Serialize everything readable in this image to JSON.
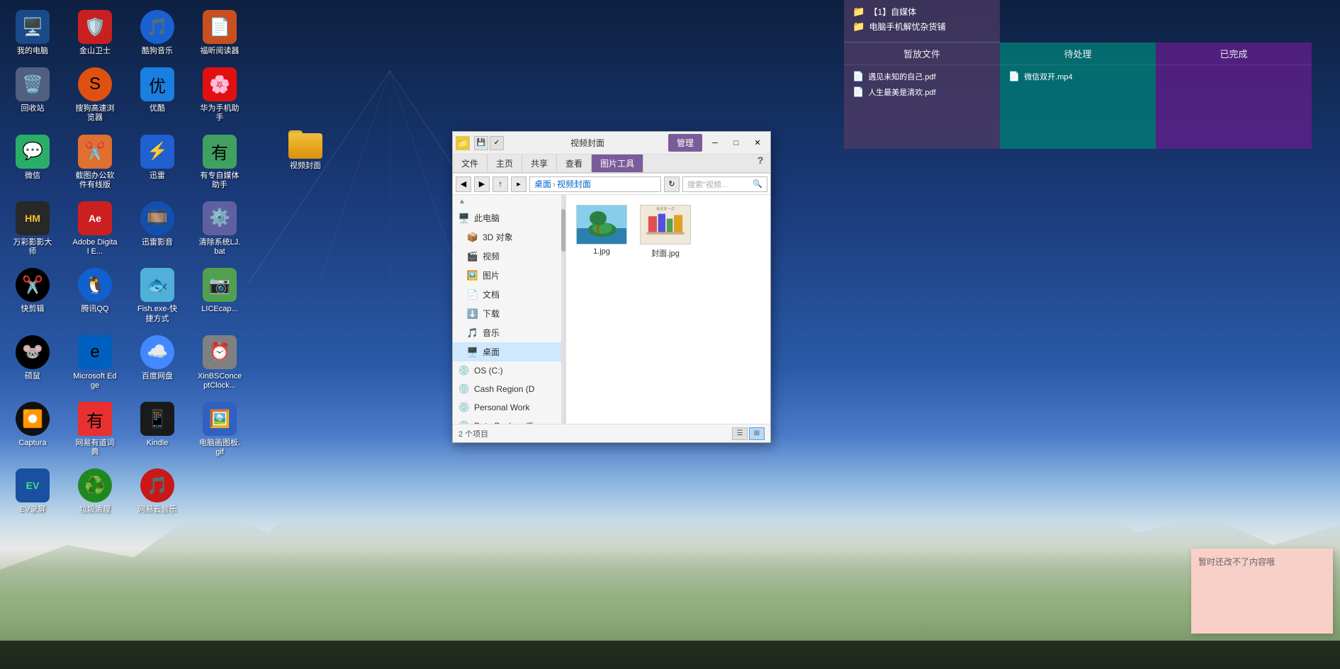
{
  "desktop": {
    "bg_gradient": "linear-gradient(180deg, #0d2040, #2a5aa8, #8ab4e0, #c8dce8)",
    "icons": [
      {
        "id": "my-computer",
        "label": "我的电脑",
        "emoji": "🖥️",
        "color": "#4488cc"
      },
      {
        "id": "jinshan-guard",
        "label": "金山卫士",
        "emoji": "🛡️",
        "color": "#e85050"
      },
      {
        "id": "kugou-music",
        "label": "酷狗音乐",
        "emoji": "🎵",
        "color": "#4488ff"
      },
      {
        "id": "fuyin-reader",
        "label": "福昕阅读器",
        "emoji": "📄",
        "color": "#e06020"
      },
      {
        "id": "recycle-bin",
        "label": "回收站",
        "emoji": "🗑️",
        "color": "#80a0c0"
      },
      {
        "id": "sogou-browser",
        "label": "搜狗高速浏览器",
        "emoji": "🔍",
        "color": "#f07020"
      },
      {
        "id": "youku",
        "label": "优酷",
        "emoji": "▶️",
        "color": "#2090e8"
      },
      {
        "id": "huawei-phone",
        "label": "华为手机助手",
        "emoji": "📱",
        "color": "#e82020"
      },
      {
        "id": "wechat",
        "label": "微信",
        "emoji": "💬",
        "color": "#2aae67"
      },
      {
        "id": "jietuban",
        "label": "截图办公软件有线版",
        "emoji": "✂️",
        "color": "#f08030"
      },
      {
        "id": "xunlei",
        "label": "迅雷",
        "emoji": "⚡",
        "color": "#2080e8"
      },
      {
        "id": "youzhuanmei",
        "label": "有专自媒体助手",
        "emoji": "🎬",
        "color": "#40a860"
      },
      {
        "id": "wansai",
        "label": "万彩影影大师",
        "emoji": "🎭",
        "color": "#303030"
      },
      {
        "id": "adobe-digital",
        "label": "Adobe Digital E...",
        "emoji": "📚",
        "color": "#cc2020"
      },
      {
        "id": "xunlei-shadow",
        "label": "迅雷影音",
        "emoji": "🎞️",
        "color": "#1060c0"
      },
      {
        "id": "qingjie-bat",
        "label": "清除系统LJ.bat",
        "emoji": "⚙️",
        "color": "#8080a0"
      },
      {
        "id": "kuaijian",
        "label": "快剪辑",
        "emoji": "✂️",
        "color": "#20a0e0"
      },
      {
        "id": "tencent-qq",
        "label": "腾讯QQ",
        "emoji": "🐧",
        "color": "#1a78d8"
      },
      {
        "id": "fish-exe",
        "label": "Fish.exe-快捷方式",
        "emoji": "🐟",
        "color": "#60c0e0"
      },
      {
        "id": "licecap",
        "label": "LICEcap...",
        "emoji": "🖼️",
        "color": "#60a060"
      },
      {
        "id": "shuoshu",
        "label": "硕鼠",
        "emoji": "🐭",
        "color": "#d04820"
      },
      {
        "id": "microsoft-edge",
        "label": "Microsoft Edge",
        "emoji": "🌐",
        "color": "#0078d4"
      },
      {
        "id": "baidu-pan",
        "label": "百度网盘",
        "emoji": "☁️",
        "color": "#4488ff"
      },
      {
        "id": "xinbsconc",
        "label": "XinBSConceptClock...",
        "emoji": "⏰",
        "color": "#888888"
      },
      {
        "id": "captura",
        "label": "Captura",
        "emoji": "🎥",
        "color": "#303030"
      },
      {
        "id": "youdao-dict",
        "label": "网易有道词典",
        "emoji": "📖",
        "color": "#e85050"
      },
      {
        "id": "kindle",
        "label": "Kindle",
        "emoji": "📱",
        "color": "#1a1a1a"
      },
      {
        "id": "pc-draw-gif",
        "label": "电脑画图板.gif",
        "emoji": "🖼️",
        "color": "#4080c0"
      },
      {
        "id": "ev-recorder",
        "label": "EV录屏",
        "emoji": "⏺️",
        "color": "#2060a0"
      },
      {
        "id": "trash-clean",
        "label": "垃圾清理",
        "emoji": "♻️",
        "color": "#40b840"
      },
      {
        "id": "netease-music",
        "label": "网易云音乐",
        "emoji": "🎵",
        "color": "#e82020"
      }
    ],
    "folder_label": "视频封面"
  },
  "sticky_panel": {
    "col1": {
      "header": "暂放文件",
      "color": "#7a5880",
      "items": [
        {
          "text": "遇见未知的自己.pdf",
          "icon": "📄"
        },
        {
          "text": "人生最美是清欢.pdf",
          "icon": "📄"
        }
      ]
    },
    "col2": {
      "header": "待处理",
      "color": "#009688",
      "items": [
        {
          "text": "微信双开.mp4",
          "icon": "🎥"
        }
      ]
    },
    "col3": {
      "header": "已完成",
      "color": "#7b2fbe",
      "items": []
    },
    "folder1": {
      "text": "【1】自媒体"
    },
    "folder2": {
      "text": "电脑手机解忧杂货铺"
    }
  },
  "file_window": {
    "title": "视频封面",
    "tab_manage": "管理",
    "ribbon_tabs": [
      "文件",
      "主页",
      "共享",
      "查看",
      "图片工具"
    ],
    "active_tab": "图片工具",
    "address": {
      "segments": [
        "桌面",
        "视频封面"
      ],
      "search_placeholder": "搜索\"视频..."
    },
    "sidebar_items": [
      {
        "label": "此电脑",
        "icon": "🖥️",
        "type": "header"
      },
      {
        "label": "3D 对象",
        "icon": "📦",
        "type": "item"
      },
      {
        "label": "视频",
        "icon": "🎬",
        "type": "item"
      },
      {
        "label": "图片",
        "icon": "🖼️",
        "type": "item"
      },
      {
        "label": "文档",
        "icon": "📄",
        "type": "item"
      },
      {
        "label": "下载",
        "icon": "⬇️",
        "type": "item"
      },
      {
        "label": "音乐",
        "icon": "🎵",
        "type": "item"
      },
      {
        "label": "桌面",
        "icon": "🖥️",
        "type": "item",
        "active": true
      },
      {
        "label": "OS (C:)",
        "icon": "💾",
        "type": "item"
      },
      {
        "label": "Cash Region (D",
        "icon": "💾",
        "type": "item"
      },
      {
        "label": "Personal Work",
        "icon": "💾",
        "type": "item"
      },
      {
        "label": "Data Backup (F:",
        "icon": "💾",
        "type": "item"
      }
    ],
    "files": [
      {
        "name": "1.jpg",
        "thumb_type": "island"
      },
      {
        "name": "封面.jpg",
        "thumb_type": "books"
      }
    ],
    "status": {
      "count": "2 个项目",
      "view_list": "☰",
      "view_large": "⊞"
    }
  },
  "pink_note": {
    "text": "暂时还改不了内容哦"
  }
}
